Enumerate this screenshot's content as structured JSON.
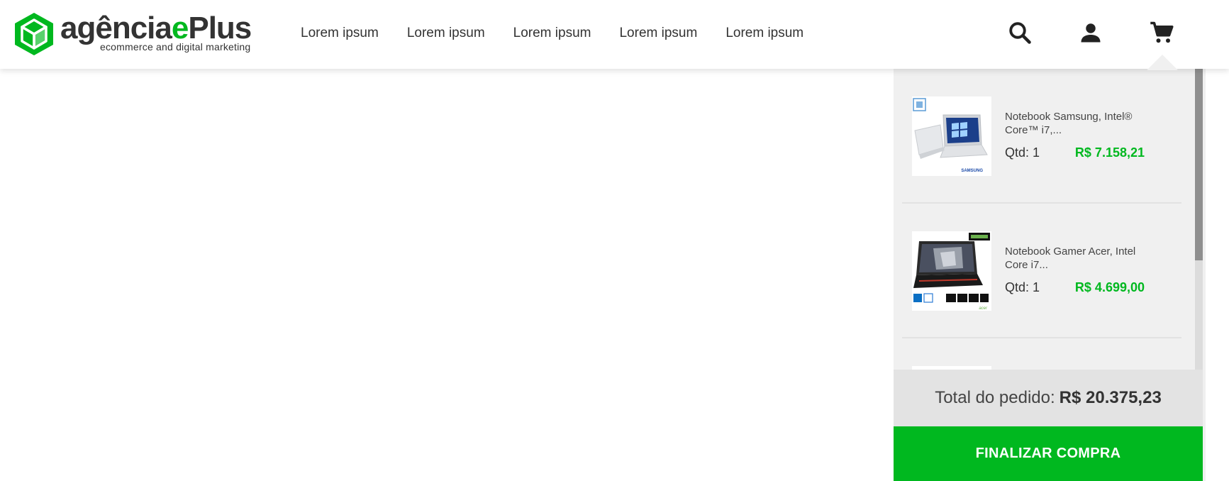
{
  "brand": {
    "name_part1": "agência",
    "name_part2": "e",
    "name_part3": "Plus",
    "tagline": "ecommerce and digital marketing",
    "accent_color": "#00b81f"
  },
  "nav": {
    "items": [
      {
        "label": "Lorem ipsum"
      },
      {
        "label": "Lorem ipsum"
      },
      {
        "label": "Lorem ipsum"
      },
      {
        "label": "Lorem ipsum"
      },
      {
        "label": "Lorem ipsum"
      }
    ]
  },
  "header_icons": {
    "search": "search-icon",
    "account": "user-icon",
    "cart": "cart-icon"
  },
  "cart": {
    "items": [
      {
        "name": "Notebook Samsung, Intel® Core™ i7,...",
        "qty_label": "Qtd: 1",
        "price": "R$ 7.158,21",
        "thumb_brand": "SAMSUNG"
      },
      {
        "name": "Notebook Gamer Acer, Intel Core i7...",
        "qty_label": "Qtd: 1",
        "price": "R$ 4.699,00",
        "thumb_brand": "acer"
      }
    ],
    "total_label": "Total do pedido:",
    "total_value": "R$ 20.375,23",
    "checkout_label": "FINALIZAR COMPRA"
  }
}
